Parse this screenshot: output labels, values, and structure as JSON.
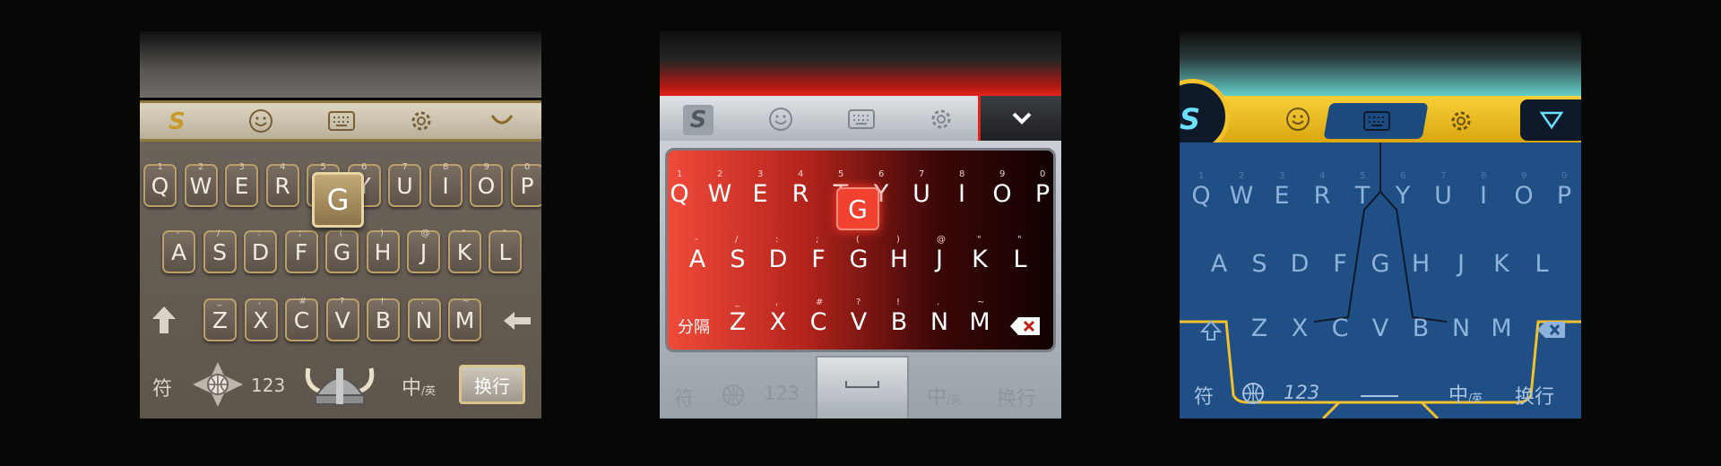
{
  "keyboards": [
    {
      "theme": "wood",
      "colors": {
        "accent": "#b9a06a",
        "body": "#635a51"
      },
      "toolbar": {
        "logo": "S",
        "icons": [
          "emoji-icon",
          "keyboard-icon",
          "settings-icon",
          "collapse-icon"
        ]
      },
      "row1": [
        {
          "k": "Q",
          "h": "1"
        },
        {
          "k": "W",
          "h": "2"
        },
        {
          "k": "E",
          "h": "3"
        },
        {
          "k": "R",
          "h": "4"
        },
        {
          "k": "T",
          "h": "5"
        },
        {
          "k": "Y",
          "h": "6"
        },
        {
          "k": "U",
          "h": "7"
        },
        {
          "k": "I",
          "h": "8"
        },
        {
          "k": "O",
          "h": "9"
        },
        {
          "k": "P",
          "h": "0"
        }
      ],
      "row2": [
        {
          "k": "A",
          "h": "-"
        },
        {
          "k": "S",
          "h": "/"
        },
        {
          "k": "D",
          "h": ":"
        },
        {
          "k": "F",
          "h": ";"
        },
        {
          "k": "G",
          "h": "("
        },
        {
          "k": "H",
          "h": ")"
        },
        {
          "k": "J",
          "h": "@"
        },
        {
          "k": "K",
          "h": "\""
        },
        {
          "k": "L",
          "h": "\""
        }
      ],
      "row3": [
        {
          "k": "Z",
          "h": "_"
        },
        {
          "k": "X",
          "h": ","
        },
        {
          "k": "C",
          "h": "#"
        },
        {
          "k": "V",
          "h": "?"
        },
        {
          "k": "B",
          "h": "!"
        },
        {
          "k": "N",
          "h": "."
        },
        {
          "k": "M",
          "h": "~"
        }
      ],
      "pressed": "G",
      "bottom": {
        "symbol": "符",
        "num": "123",
        "lang_main": "中",
        "lang_sub": "/英",
        "enter": "换行"
      }
    },
    {
      "theme": "red",
      "colors": {
        "accent": "#e2231a",
        "body": "#b7bec4"
      },
      "toolbar": {
        "logo": "S",
        "icons": [
          "emoji-icon",
          "keyboard-icon",
          "settings-icon",
          "chevron-down-icon"
        ]
      },
      "row1": [
        {
          "k": "Q",
          "h": "1"
        },
        {
          "k": "W",
          "h": "2"
        },
        {
          "k": "E",
          "h": "3"
        },
        {
          "k": "R",
          "h": "4"
        },
        {
          "k": "T",
          "h": "5"
        },
        {
          "k": "Y",
          "h": "6"
        },
        {
          "k": "U",
          "h": "7"
        },
        {
          "k": "I",
          "h": "8"
        },
        {
          "k": "O",
          "h": "9"
        },
        {
          "k": "P",
          "h": "0"
        }
      ],
      "row2": [
        {
          "k": "A",
          "h": "-"
        },
        {
          "k": "S",
          "h": "/"
        },
        {
          "k": "D",
          "h": ":"
        },
        {
          "k": "F",
          "h": ";"
        },
        {
          "k": "G",
          "h": "("
        },
        {
          "k": "H",
          "h": ")"
        },
        {
          "k": "J",
          "h": "@"
        },
        {
          "k": "K",
          "h": "\""
        },
        {
          "k": "L",
          "h": "\""
        }
      ],
      "row3": [
        {
          "k": "Z",
          "h": "_"
        },
        {
          "k": "X",
          "h": ","
        },
        {
          "k": "C",
          "h": "#"
        },
        {
          "k": "V",
          "h": "?"
        },
        {
          "k": "B",
          "h": "!"
        },
        {
          "k": "N",
          "h": "."
        },
        {
          "k": "M",
          "h": "~"
        }
      ],
      "pressed": "G",
      "separator": "分隔",
      "bottom": {
        "symbol": "符",
        "num": "123",
        "lang_main": "中",
        "lang_sub": "/英",
        "enter": "换行"
      }
    },
    {
      "theme": "blue",
      "colors": {
        "accent": "#f2c12b",
        "body": "#1f4f85"
      },
      "toolbar": {
        "logo": "S",
        "icons": [
          "emoji-icon",
          "keyboard-icon",
          "settings-icon",
          "dropdown-icon"
        ]
      },
      "row1": [
        {
          "k": "Q",
          "h": "1"
        },
        {
          "k": "W",
          "h": "2"
        },
        {
          "k": "E",
          "h": "3"
        },
        {
          "k": "R",
          "h": "4"
        },
        {
          "k": "T",
          "h": "5"
        },
        {
          "k": "Y",
          "h": "6"
        },
        {
          "k": "U",
          "h": "7"
        },
        {
          "k": "I",
          "h": "8"
        },
        {
          "k": "O",
          "h": "9"
        },
        {
          "k": "P",
          "h": "0"
        }
      ],
      "row2": [
        {
          "k": "A",
          "h": ""
        },
        {
          "k": "S",
          "h": ""
        },
        {
          "k": "D",
          "h": ""
        },
        {
          "k": "F",
          "h": ""
        },
        {
          "k": "G",
          "h": ""
        },
        {
          "k": "H",
          "h": ""
        },
        {
          "k": "J",
          "h": ""
        },
        {
          "k": "K",
          "h": ""
        },
        {
          "k": "L",
          "h": ""
        }
      ],
      "row3": [
        {
          "k": "Z",
          "h": ""
        },
        {
          "k": "X",
          "h": ""
        },
        {
          "k": "C",
          "h": ""
        },
        {
          "k": "V",
          "h": ""
        },
        {
          "k": "B",
          "h": ""
        },
        {
          "k": "N",
          "h": ""
        },
        {
          "k": "M",
          "h": ""
        }
      ],
      "bottom": {
        "symbol": "符",
        "num": "123",
        "lang_main": "中",
        "lang_sub": "/英",
        "enter": "换行"
      }
    }
  ]
}
